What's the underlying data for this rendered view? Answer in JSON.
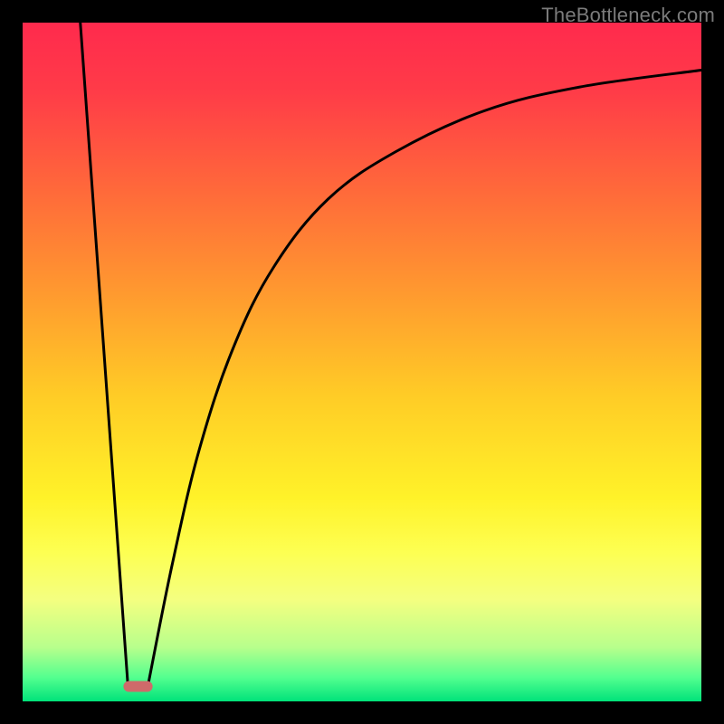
{
  "attribution": "TheBottleneck.com",
  "chart_data": {
    "type": "line",
    "title": "",
    "xlabel": "",
    "ylabel": "",
    "xlim": [
      0,
      100
    ],
    "ylim": [
      0,
      100
    ],
    "grid": false,
    "legend": false,
    "background_gradient": {
      "stops": [
        {
          "offset": 0.0,
          "color": "#ff2a4d"
        },
        {
          "offset": 0.1,
          "color": "#ff3b48"
        },
        {
          "offset": 0.25,
          "color": "#ff6a3a"
        },
        {
          "offset": 0.4,
          "color": "#ff9a2f"
        },
        {
          "offset": 0.55,
          "color": "#ffcc26"
        },
        {
          "offset": 0.7,
          "color": "#fff229"
        },
        {
          "offset": 0.78,
          "color": "#fdff52"
        },
        {
          "offset": 0.85,
          "color": "#f4ff80"
        },
        {
          "offset": 0.92,
          "color": "#b8ff8c"
        },
        {
          "offset": 0.965,
          "color": "#53ff8f"
        },
        {
          "offset": 1.0,
          "color": "#00e27a"
        }
      ]
    },
    "series": [
      {
        "name": "left-descent",
        "x": [
          8.5,
          15.5
        ],
        "y": [
          100,
          2.5
        ]
      },
      {
        "name": "right-ascent",
        "x": [
          18.5,
          22,
          26,
          31,
          37,
          45,
          55,
          68,
          82,
          100
        ],
        "y": [
          2.5,
          20,
          37,
          52,
          64,
          74,
          81,
          87,
          90.5,
          93
        ]
      }
    ],
    "marker": {
      "name": "min-point",
      "x": 17,
      "y": 2.2,
      "width_pct": 4.3,
      "height_pct": 1.6,
      "color": "#cf6a6a"
    }
  }
}
